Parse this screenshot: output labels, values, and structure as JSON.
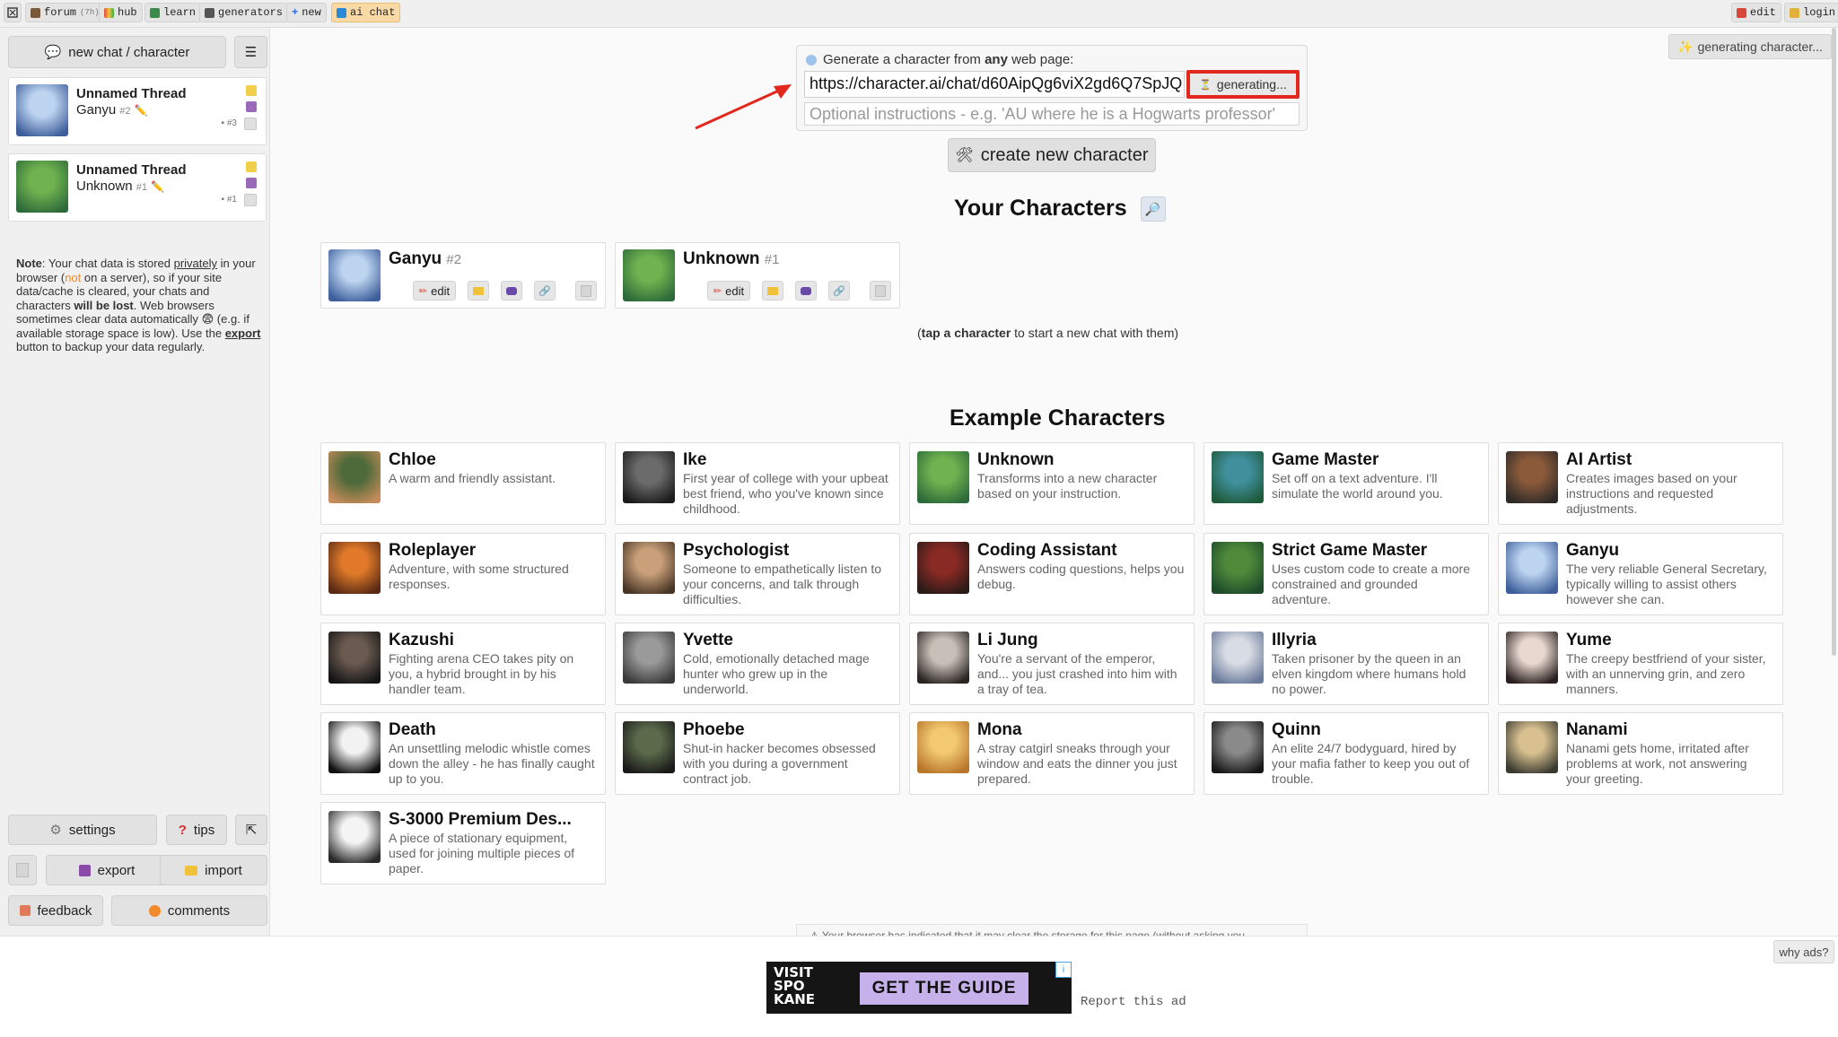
{
  "topbar": {
    "left": [
      {
        "id": "home",
        "label": ""
      },
      {
        "id": "forum",
        "label": "forum",
        "sub": "(7h)"
      },
      {
        "id": "hub",
        "label": "hub"
      },
      {
        "id": "learn",
        "label": "learn"
      },
      {
        "id": "generators",
        "label": "generators"
      },
      {
        "id": "new",
        "label": "new"
      },
      {
        "id": "ai-chat",
        "label": "ai chat"
      }
    ],
    "right": [
      {
        "id": "edit",
        "label": "edit"
      },
      {
        "id": "login",
        "label": "login"
      }
    ]
  },
  "sidebar": {
    "new_chat_label": "new chat / character",
    "threads": [
      {
        "title": "Unnamed Thread",
        "character": "Ganyu",
        "num": "#2",
        "count": "#3",
        "avatar": "ganyu"
      },
      {
        "title": "Unnamed Thread",
        "character": "Unknown",
        "num": "#1",
        "count": "#1",
        "avatar": "egg"
      }
    ],
    "note": {
      "p1": "Note",
      "p2": ": Your chat data is stored ",
      "p3": "privately",
      "p4": " in your browser (",
      "p5": "not",
      "p6": " on a server), so if your site data/cache is cleared, your chats and characters ",
      "p7": "will be lost",
      "p8": ". Web browsers sometimes clear data automatically 😨 (e.g. if available storage space is low). Use the ",
      "p9": "export",
      "p10": " button to backup your data regularly."
    },
    "buttons": {
      "settings": "settings",
      "tips": "tips",
      "export": "export",
      "import": "import",
      "feedback": "feedback",
      "comments": "comments"
    }
  },
  "generator": {
    "label_pre": "Generate a character from ",
    "label_bold": "any",
    "label_post": " web page:",
    "url_value": "https://character.ai/chat/d60AipQg6viX2gd6Q7SpJQ",
    "generating_label": "generating...",
    "instructions_placeholder": "Optional instructions - e.g. 'AU where he is a Hogwarts professor'",
    "status_button": "generating character...",
    "create_label": "create new character"
  },
  "your_characters": {
    "title": "Your Characters",
    "items": [
      {
        "name": "Ganyu",
        "num": "#2",
        "avatar": "ganyu"
      },
      {
        "name": "Unknown",
        "num": "#1",
        "avatar": "egg"
      }
    ],
    "edit_label": "edit",
    "hint_bold": "tap a character",
    "hint_rest": " to start a new chat with them)",
    "hint_open": "("
  },
  "examples": {
    "title": "Example Characters",
    "items": [
      {
        "name": "Chloe",
        "desc": "A warm and friendly assistant.",
        "avatar": "chloe"
      },
      {
        "name": "Ike",
        "desc": "First year of college with your upbeat best friend, who you've known since childhood.",
        "avatar": "ike"
      },
      {
        "name": "Unknown",
        "desc": "Transforms into a new character based on your instruction.",
        "avatar": "egg"
      },
      {
        "name": "Game Master",
        "desc": "Set off on a text adventure. I'll simulate the world around you.",
        "avatar": "gamemaster"
      },
      {
        "name": "AI Artist",
        "desc": "Creates images based on your instructions and requested adjustments.",
        "avatar": "artist"
      },
      {
        "name": "Roleplayer",
        "desc": "Adventure, with some structured responses.",
        "avatar": "roleplayer"
      },
      {
        "name": "Psychologist",
        "desc": "Someone to empathetically listen to your concerns, and talk through difficulties.",
        "avatar": "psych"
      },
      {
        "name": "Coding Assistant",
        "desc": "Answers coding questions, helps you debug.",
        "avatar": "coder"
      },
      {
        "name": "Strict Game Master",
        "desc": "Uses custom code to create a more constrained and grounded adventure.",
        "avatar": "strictgm"
      },
      {
        "name": "Ganyu",
        "desc": "The very reliable General Secretary, typically willing to assist others however she can.",
        "avatar": "ganyu"
      },
      {
        "name": "Kazushi",
        "desc": "Fighting arena CEO takes pity on you, a hybrid brought in by his handler team.",
        "avatar": "kazushi"
      },
      {
        "name": "Yvette",
        "desc": "Cold, emotionally detached mage hunter who grew up in the underworld.",
        "avatar": "yvette"
      },
      {
        "name": "Li Jung",
        "desc": "You're a servant of the emperor, and... you just crashed into him with a tray of tea.",
        "avatar": "lijung"
      },
      {
        "name": "Illyria",
        "desc": "Taken prisoner by the queen in an elven kingdom where humans hold no power.",
        "avatar": "illyria"
      },
      {
        "name": "Yume",
        "desc": "The creepy bestfriend of your sister, with an unnerving grin, and zero manners.",
        "avatar": "yume"
      },
      {
        "name": "Death",
        "desc": "An unsettling melodic whistle comes down the alley - he has finally caught up to you.",
        "avatar": "death"
      },
      {
        "name": "Phoebe",
        "desc": "Shut-in hacker becomes obsessed with you during a government contract job.",
        "avatar": "phoebe"
      },
      {
        "name": "Mona",
        "desc": "A stray catgirl sneaks through your window and eats the dinner you just prepared.",
        "avatar": "mona"
      },
      {
        "name": "Quinn",
        "desc": "An elite 24/7 bodyguard, hired by your mafia father to keep you out of trouble.",
        "avatar": "quinn"
      },
      {
        "name": "Nanami",
        "desc": "Nanami gets home, irritated after problems at work, not answering your greeting.",
        "avatar": "nanami"
      },
      {
        "name": "S-3000 Premium Des...",
        "desc": "A piece of stationary equipment, used for joining multiple pieces of paper.",
        "avatar": "stapler"
      }
    ]
  },
  "bottom_note": "Your browser has indicated that it may clear the storage for this page (without asking you",
  "ad": {
    "logo_lines": [
      "VISIT",
      "SPO",
      "KANE"
    ],
    "cta": "GET THE GUIDE",
    "report": "Report this ad",
    "why": "why ads?",
    "info": "i"
  },
  "avatars": {
    "ganyu": [
      "#bcd4f0",
      "#3e5f9c"
    ],
    "egg": [
      "#6fb24f",
      "#2e6b3a"
    ],
    "chloe": [
      "#4e6a3a",
      "#c58b5a"
    ],
    "ike": [
      "#6b6b6b",
      "#1c1c1c"
    ],
    "gamemaster": [
      "#3f8f9c",
      "#1f5a3a"
    ],
    "artist": [
      "#8a5a3a",
      "#2e2a28"
    ],
    "roleplayer": [
      "#e07a2a",
      "#5a2a14"
    ],
    "psych": [
      "#c9a07a",
      "#4a3626"
    ],
    "coder": [
      "#8a2a24",
      "#2a1a18"
    ],
    "strictgm": [
      "#4e8a3a",
      "#1e4a2a"
    ],
    "kazushi": [
      "#6a5a50",
      "#151515"
    ],
    "yvette": [
      "#9a9a9a",
      "#3a3a3a"
    ],
    "lijung": [
      "#c8c0b8",
      "#2a2422"
    ],
    "illyria": [
      "#d8dce4",
      "#6a7a9a"
    ],
    "yume": [
      "#e8d8d0",
      "#2a2020"
    ],
    "death": [
      "#f2f2f2",
      "#101010"
    ],
    "phoebe": [
      "#5a6a4a",
      "#1a1a1a"
    ],
    "mona": [
      "#f2c870",
      "#b8762a"
    ],
    "quinn": [
      "#8a8a8a",
      "#181818"
    ],
    "nanami": [
      "#d8c090",
      "#3a3a30"
    ],
    "stapler": [
      "#f4f4f4",
      "#2a2a2a"
    ]
  }
}
